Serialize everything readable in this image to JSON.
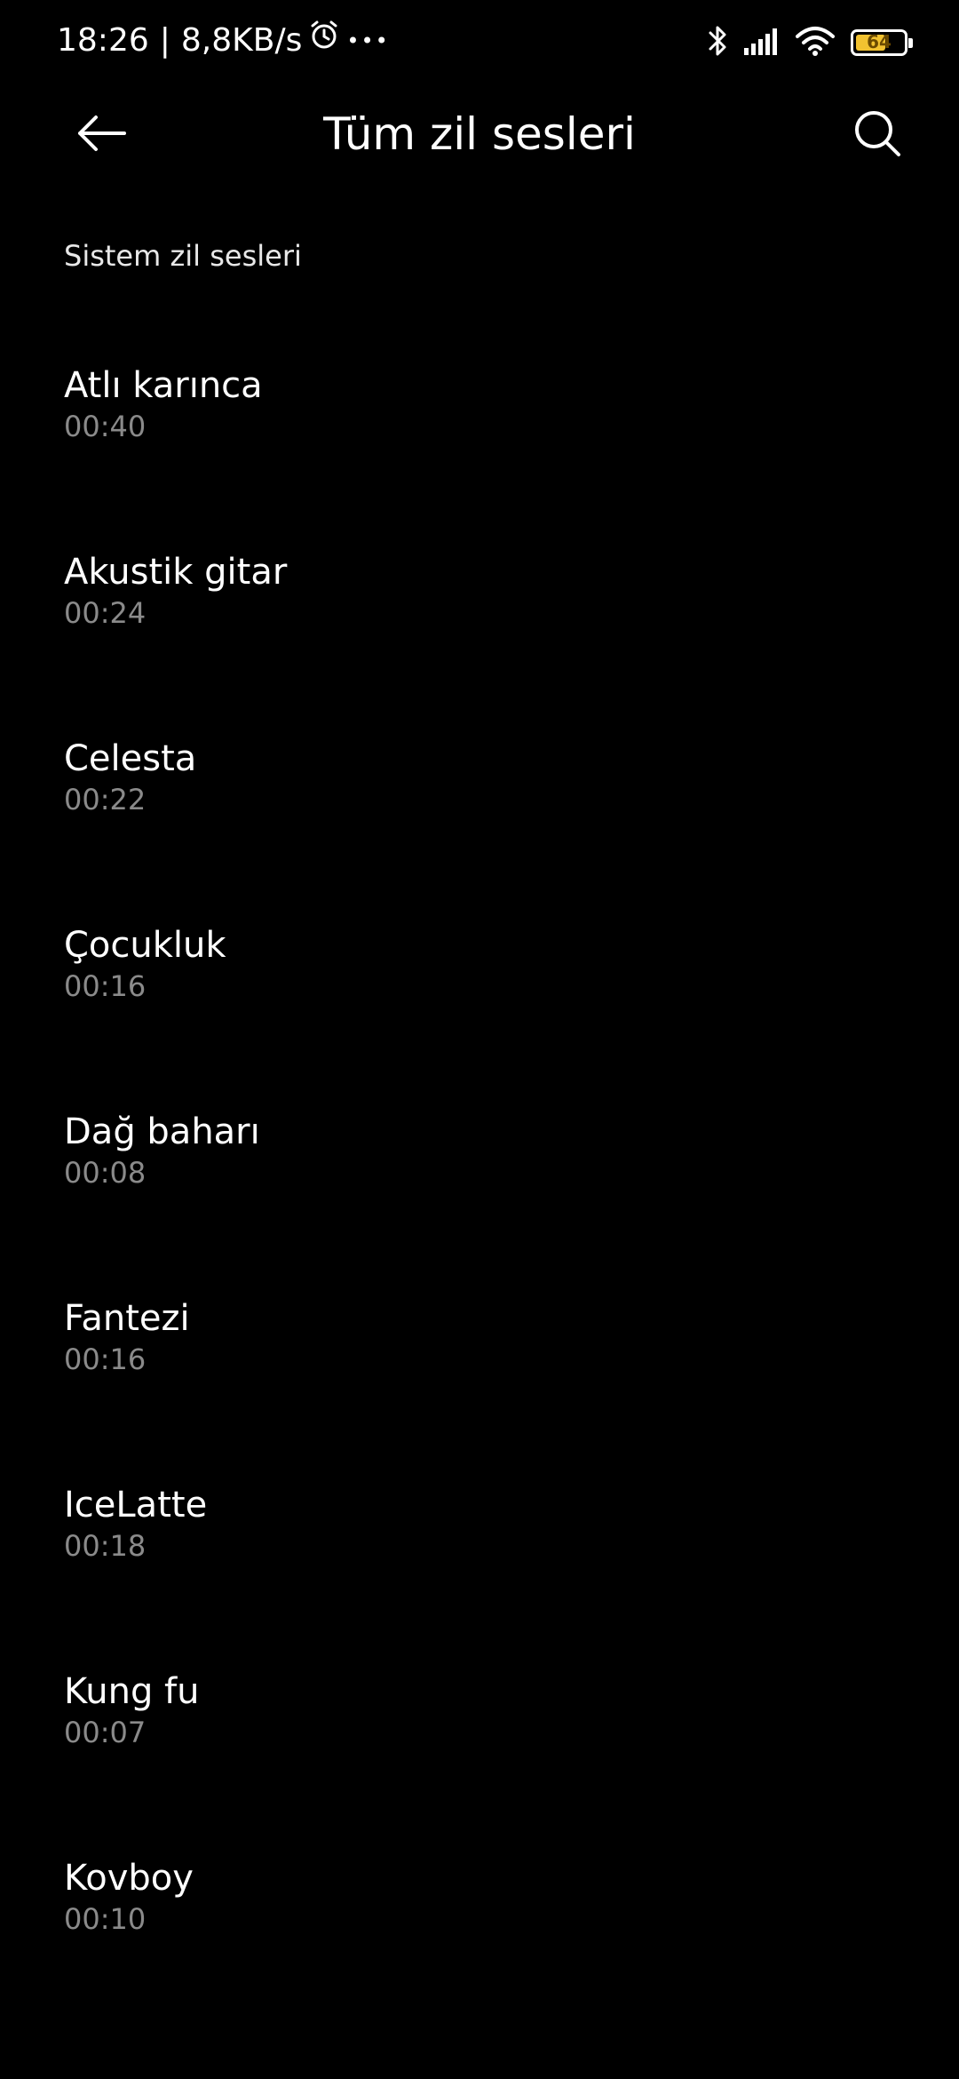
{
  "status_bar": {
    "time": "18:26",
    "separator": "|",
    "network_speed": "8,8KB/s",
    "more_indicator": "•••",
    "battery_level": "64",
    "battery_fraction": 0.64,
    "battery_color": "#f2c230",
    "icons": [
      "alarm-icon",
      "bluetooth-icon",
      "signal-icon",
      "wifi-icon",
      "battery-icon"
    ]
  },
  "app_bar": {
    "title": "Tüm zil sesleri",
    "back_icon": "back-arrow-icon",
    "search_icon": "search-icon"
  },
  "section": {
    "header": "Sistem zil sesleri"
  },
  "ringtones": [
    {
      "title": "Atlı karınca",
      "duration": "00:40"
    },
    {
      "title": "Akustik gitar",
      "duration": "00:24"
    },
    {
      "title": "Celesta",
      "duration": "00:22"
    },
    {
      "title": "Çocukluk",
      "duration": "00:16"
    },
    {
      "title": "Dağ baharı",
      "duration": "00:08"
    },
    {
      "title": "Fantezi",
      "duration": "00:16"
    },
    {
      "title": "IceLatte",
      "duration": "00:18"
    },
    {
      "title": "Kung fu",
      "duration": "00:07"
    },
    {
      "title": "Kovboy",
      "duration": "00:10"
    }
  ]
}
